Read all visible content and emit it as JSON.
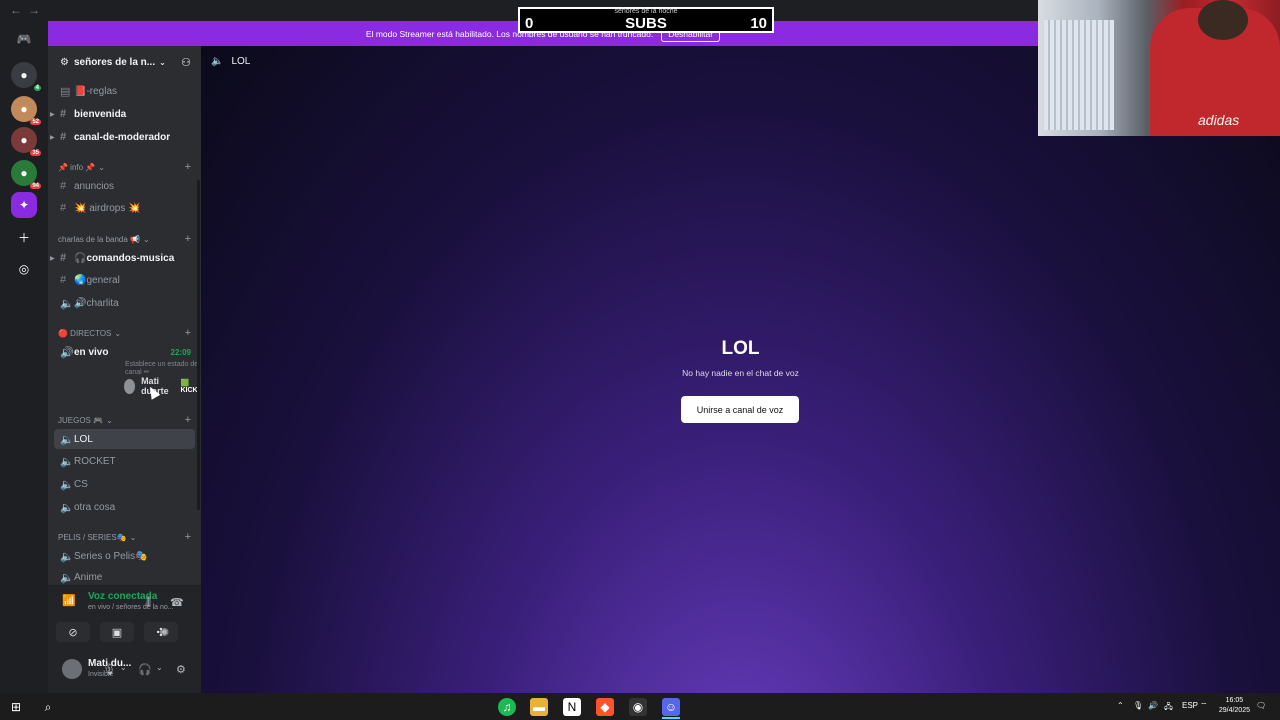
{
  "banner": {
    "text": "El modo Streamer está habilitado. Los nombres de usuario se han truncado.",
    "disable_label": "Deshabilitar"
  },
  "subs_overlay": {
    "title": "señores de la noche",
    "left": "0",
    "label": "SUBS",
    "right": "10"
  },
  "server": {
    "name": "señores de la n...",
    "channels_top": [
      {
        "label": "📕-reglas",
        "glyph": "#",
        "bold": false
      },
      {
        "label": "bienvenida",
        "glyph": "#",
        "bold": true
      },
      {
        "label": "canal-de-moderador",
        "glyph": "#",
        "bold": true
      }
    ],
    "categories": {
      "info": "📌 info 📌",
      "charlas": "charlas de la banda 📢",
      "directos": "🔴 DIRECTOS",
      "juegos": "JUEGOS 🎮",
      "pelis": "PELIS / SERIES🎭"
    },
    "info_channels": [
      {
        "label": "anuncios"
      },
      {
        "label": "💥 airdrops 💥"
      }
    ],
    "charlas_channels": [
      {
        "label": "🎧comandos-musica"
      },
      {
        "label": "🌏general"
      },
      {
        "label": "🔊charlita"
      }
    ],
    "directos_channel": {
      "label": "en vivo",
      "time": "22:09",
      "status": "Establece un estado de canal ✏"
    },
    "voice_user": {
      "name": "Mati duarte",
      "kick_prefix": "🟩",
      "kick": "KICK"
    },
    "juegos_channels": [
      {
        "label": "LOL"
      },
      {
        "label": "ROCKET"
      },
      {
        "label": "CS"
      },
      {
        "label": "otra cosa"
      }
    ],
    "pelis_channels": [
      {
        "label": "Series o Pelis🎭"
      },
      {
        "label": "Anime"
      }
    ]
  },
  "voice_panel": {
    "title": "Voz conectada",
    "subtitle": "en vivo / señores de la no..."
  },
  "user": {
    "name": "Mati du...",
    "status": "Invisible"
  },
  "main": {
    "header_channel": "LOL",
    "title": "LOL",
    "subtitle": "No hay nadie en el chat de voz",
    "join_label": "Unirse a canal de voz"
  },
  "webcam": {
    "brand_text": "adidas"
  },
  "taskbar": {
    "lang": "ESP",
    "time": "16:05",
    "date": "29/4/2025"
  },
  "colors": {
    "banner": "#8a2be2",
    "voice_green": "#23a559",
    "sidebar": "#2b2d31",
    "rail": "#1e1f22"
  }
}
